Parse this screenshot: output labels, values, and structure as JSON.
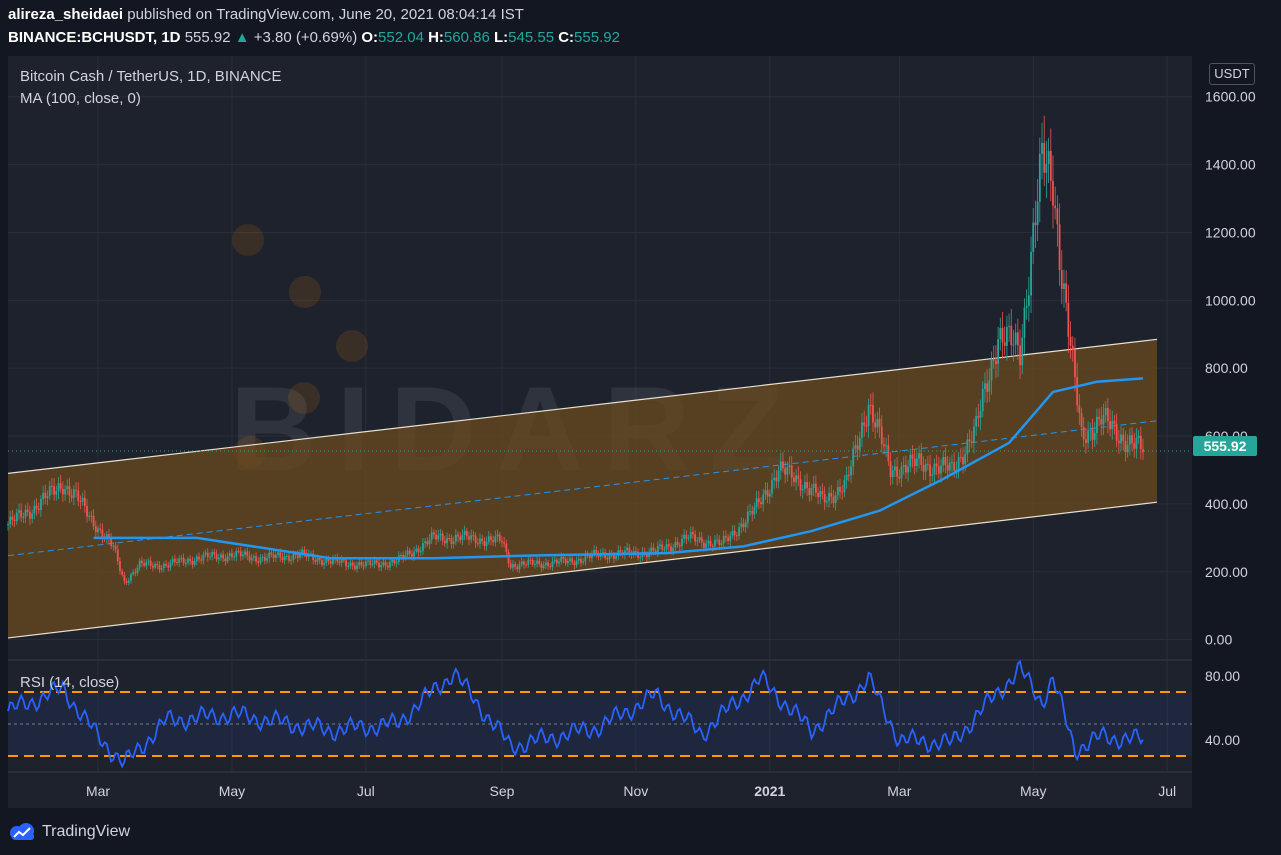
{
  "header": {
    "author": "alireza_sheidaei",
    "published_text": "published on TradingView.com, June 20, 2021 08:04:14 IST",
    "symbol": "BINANCE:BCHUSDT, 1D",
    "last_price": "555.92",
    "change": "+3.80 (+0.69%)",
    "open_label": "O:",
    "open_value": "552.04",
    "high_label": "H:",
    "high_value": "560.86",
    "low_label": "L:",
    "low_value": "545.55",
    "close_label": "C:",
    "close_value": "555.92"
  },
  "legend": {
    "title": "Bitcoin Cash / TetherUS, 1D, BINANCE",
    "ma": "MA (100, close, 0)",
    "rsi": "RSI (14, close)"
  },
  "price_axis": {
    "unit": "USDT",
    "ticks": [
      "1600.00",
      "1400.00",
      "1200.00",
      "1000.00",
      "800.00",
      "600.00",
      "400.00",
      "200.00",
      "0.00"
    ],
    "current_price": "555.92"
  },
  "rsi_axis": {
    "ticks": [
      "80.00",
      "40.00"
    ]
  },
  "time_axis": {
    "labels": [
      "Mar",
      "May",
      "Jul",
      "Sep",
      "Nov",
      "2021",
      "Mar",
      "May",
      "Jul"
    ]
  },
  "watermark": {
    "text": "BIDARZ"
  },
  "footer": {
    "brand": "TradingView"
  },
  "colors": {
    "bull": "#26a69a",
    "bear": "#ef5350",
    "ma": "#2196f3",
    "channel_fill": "#6b4a1e",
    "rsi_line": "#2962ff",
    "rsi_band": "#ff9800"
  },
  "chart_data": [
    {
      "type": "candlestick",
      "title": "Bitcoin Cash / TetherUS, 1D, BINANCE",
      "x_range": [
        "2020-01-20",
        "2021-06-20"
      ],
      "ylim": [
        -60,
        1720
      ],
      "close": [
        [
          "2020-01-20",
          340
        ],
        [
          "2020-02-01",
          390
        ],
        [
          "2020-02-14",
          460
        ],
        [
          "2020-02-20",
          420
        ],
        [
          "2020-03-01",
          330
        ],
        [
          "2020-03-08",
          270
        ],
        [
          "2020-03-13",
          170
        ],
        [
          "2020-03-20",
          220
        ],
        [
          "2020-04-01",
          220
        ],
        [
          "2020-04-15",
          240
        ],
        [
          "2020-05-01",
          250
        ],
        [
          "2020-05-15",
          240
        ],
        [
          "2020-06-01",
          250
        ],
        [
          "2020-06-15",
          230
        ],
        [
          "2020-07-01",
          220
        ],
        [
          "2020-07-15",
          230
        ],
        [
          "2020-08-01",
          300
        ],
        [
          "2020-08-15",
          300
        ],
        [
          "2020-09-01",
          290
        ],
        [
          "2020-09-05",
          220
        ],
        [
          "2020-09-20",
          225
        ],
        [
          "2020-10-01",
          230
        ],
        [
          "2020-10-15",
          250
        ],
        [
          "2020-11-01",
          255
        ],
        [
          "2020-11-10",
          260
        ],
        [
          "2020-11-25",
          300
        ],
        [
          "2020-12-10",
          280
        ],
        [
          "2020-12-25",
          380
        ],
        [
          "2021-01-05",
          500
        ],
        [
          "2021-01-15",
          470
        ],
        [
          "2021-01-25",
          410
        ],
        [
          "2021-02-05",
          460
        ],
        [
          "2021-02-15",
          700
        ],
        [
          "2021-02-25",
          500
        ],
        [
          "2021-03-10",
          520
        ],
        [
          "2021-03-25",
          500
        ],
        [
          "2021-04-05",
          620
        ],
        [
          "2021-04-15",
          900
        ],
        [
          "2021-04-25",
          850
        ],
        [
          "2021-05-01",
          1200
        ],
        [
          "2021-05-05",
          1400
        ],
        [
          "2021-05-10",
          1350
        ],
        [
          "2021-05-13",
          1150
        ],
        [
          "2021-05-19",
          800
        ],
        [
          "2021-05-23",
          600
        ],
        [
          "2021-06-01",
          650
        ],
        [
          "2021-06-10",
          600
        ],
        [
          "2021-06-20",
          556
        ]
      ]
    },
    {
      "type": "line",
      "name": "MA (100, close, 0)",
      "points": [
        [
          "2020-02-28",
          300
        ],
        [
          "2020-04-15",
          300
        ],
        [
          "2020-06-15",
          240
        ],
        [
          "2020-08-01",
          240
        ],
        [
          "2020-09-15",
          248
        ],
        [
          "2020-11-15",
          255
        ],
        [
          "2020-12-20",
          275
        ],
        [
          "2021-01-20",
          320
        ],
        [
          "2021-02-20",
          380
        ],
        [
          "2021-03-20",
          470
        ],
        [
          "2021-04-20",
          580
        ],
        [
          "2021-05-10",
          730
        ],
        [
          "2021-05-30",
          760
        ],
        [
          "2021-06-20",
          770
        ]
      ]
    },
    {
      "type": "line",
      "name": "RSI (14, close)",
      "ylim": [
        20,
        90
      ],
      "bands": [
        70,
        30
      ],
      "points": [
        [
          "2020-01-20",
          58
        ],
        [
          "2020-02-14",
          72
        ],
        [
          "2020-03-01",
          42
        ],
        [
          "2020-03-13",
          25
        ],
        [
          "2020-04-01",
          52
        ],
        [
          "2020-05-01",
          56
        ],
        [
          "2020-06-15",
          46
        ],
        [
          "2020-07-15",
          50
        ],
        [
          "2020-08-10",
          82
        ],
        [
          "2020-09-05",
          36
        ],
        [
          "2020-10-15",
          48
        ],
        [
          "2020-11-10",
          68
        ],
        [
          "2020-12-01",
          44
        ],
        [
          "2020-12-28",
          78
        ],
        [
          "2021-01-20",
          46
        ],
        [
          "2021-02-15",
          78
        ],
        [
          "2021-03-01",
          40
        ],
        [
          "2021-03-25",
          38
        ],
        [
          "2021-04-15",
          70
        ],
        [
          "2021-04-25",
          84
        ],
        [
          "2021-05-05",
          64
        ],
        [
          "2021-05-10",
          78
        ],
        [
          "2021-05-20",
          34
        ],
        [
          "2021-06-01",
          42
        ],
        [
          "2021-06-20",
          40
        ]
      ]
    }
  ]
}
